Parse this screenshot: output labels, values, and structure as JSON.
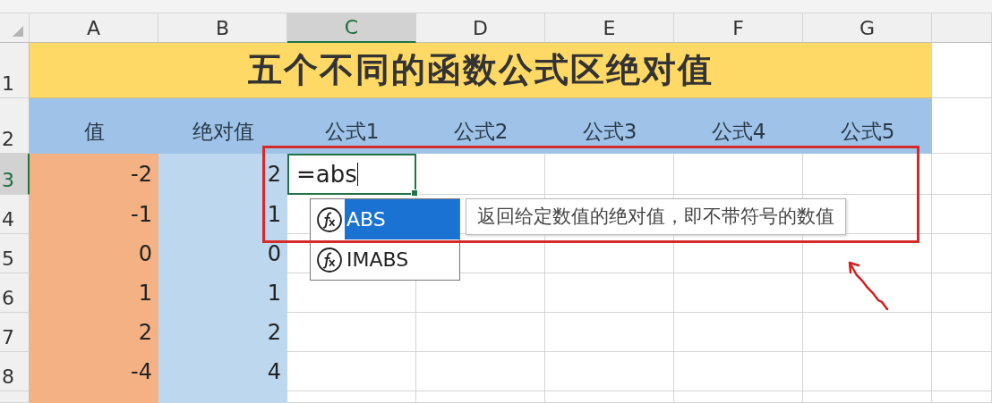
{
  "column_headers": [
    {
      "label": "A",
      "selected": false
    },
    {
      "label": "B",
      "selected": false
    },
    {
      "label": "C",
      "selected": true
    },
    {
      "label": "D",
      "selected": false
    },
    {
      "label": "E",
      "selected": false
    },
    {
      "label": "F",
      "selected": false
    },
    {
      "label": "G",
      "selected": false
    }
  ],
  "row_headers": [
    {
      "label": "1",
      "selected": false
    },
    {
      "label": "2",
      "selected": false
    },
    {
      "label": "3",
      "selected": true
    },
    {
      "label": "4",
      "selected": false
    },
    {
      "label": "5",
      "selected": false
    },
    {
      "label": "6",
      "selected": false
    },
    {
      "label": "7",
      "selected": false
    },
    {
      "label": "8",
      "selected": false
    }
  ],
  "title": "五个不同的函数公式区绝对值",
  "header_row": [
    "值",
    "绝对值",
    "公式1",
    "公式2",
    "公式3",
    "公式4",
    "公式5"
  ],
  "rows": [
    {
      "value": "-2",
      "absolute": "2"
    },
    {
      "value": "-1",
      "absolute": "1"
    },
    {
      "value": "0",
      "absolute": "0"
    },
    {
      "value": "1",
      "absolute": "1"
    },
    {
      "value": "2",
      "absolute": "2"
    },
    {
      "value": "-4",
      "absolute": "4"
    }
  ],
  "active_cell": {
    "value": "=abs"
  },
  "autocomplete": [
    {
      "name": "ABS",
      "selected": true
    },
    {
      "name": "IMABS",
      "selected": false
    }
  ],
  "tooltip": "返回给定数值的绝对值，即不带符号的数值"
}
